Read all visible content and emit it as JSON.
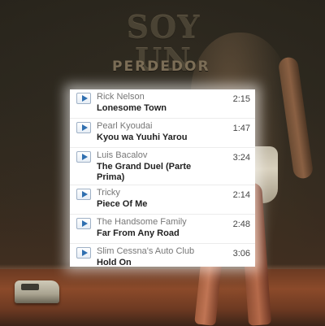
{
  "poster": {
    "title": "SOY UN",
    "subtitle": "PERDEDOR"
  },
  "playlist": {
    "tracks": [
      {
        "artist": "Rick Nelson",
        "title": "Lonesome Town",
        "duration": "2:15"
      },
      {
        "artist": "Pearl Kyoudai",
        "title": "Kyou wa Yuuhi Yarou",
        "duration": "1:47"
      },
      {
        "artist": "Luis Bacalov",
        "title": "The Grand Duel (Parte Prima)",
        "duration": "3:24"
      },
      {
        "artist": "Tricky",
        "title": "Piece Of Me",
        "duration": "2:14"
      },
      {
        "artist": "The Handsome Family",
        "title": "Far From Any Road",
        "duration": "2:48"
      },
      {
        "artist": "Slim Cessna's Auto Club",
        "title": "Hold On",
        "duration": "3:06"
      }
    ],
    "play_icon": "play-icon",
    "accent_color": "#2f6fb0"
  }
}
